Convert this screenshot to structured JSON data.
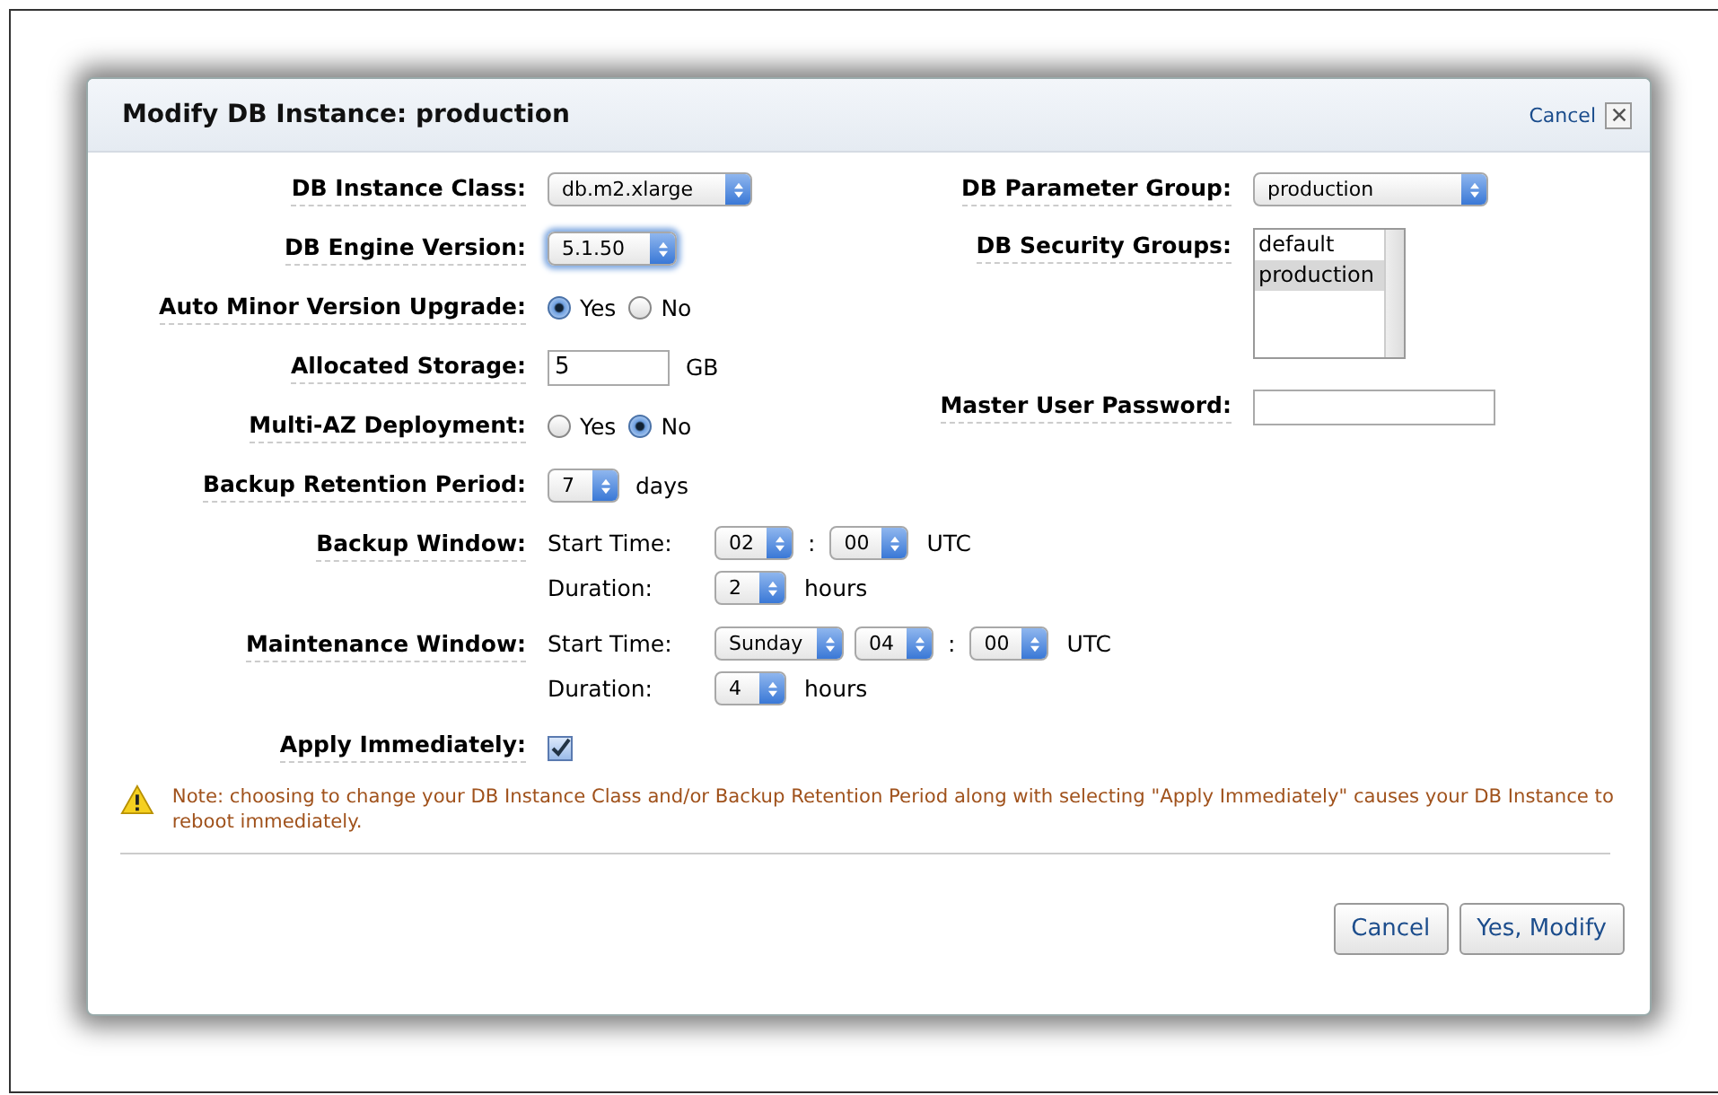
{
  "dialog": {
    "title": "Modify DB Instance: production",
    "close_link": "Cancel"
  },
  "left_fields": [
    {
      "kind": "select",
      "label": "DB Instance Class:",
      "value": "db.m2.xlarge",
      "focused": false
    },
    {
      "kind": "select",
      "label": "DB Engine Version:",
      "value": "5.1.50",
      "focused": true
    },
    {
      "kind": "radio",
      "label": "Auto Minor Version Upgrade:",
      "options": [
        {
          "label": "Yes",
          "selected": true
        },
        {
          "label": "No",
          "selected": false
        }
      ]
    },
    {
      "kind": "text",
      "label": "Allocated Storage:",
      "value": "5",
      "unit": "GB"
    },
    {
      "kind": "radio",
      "label": "Multi-AZ Deployment:",
      "options": [
        {
          "label": "Yes",
          "selected": false
        },
        {
          "label": "No",
          "selected": true
        }
      ]
    },
    {
      "kind": "select",
      "label": "Backup Retention Period:",
      "value": "7",
      "unit": "days",
      "focused": false
    },
    {
      "kind": "window",
      "label": "Backup Window:",
      "rows": [
        {
          "label": "Start Time:",
          "parts": [
            {
              "kind": "select",
              "value": "02"
            },
            {
              "kind": "sep",
              "text": ":"
            },
            {
              "kind": "select",
              "value": "00"
            },
            {
              "kind": "unit",
              "text": "UTC"
            }
          ]
        },
        {
          "label": "Duration:",
          "parts": [
            {
              "kind": "select",
              "value": "2"
            },
            {
              "kind": "unit",
              "text": "hours"
            }
          ]
        }
      ]
    },
    {
      "kind": "window",
      "label": "Maintenance Window:",
      "rows": [
        {
          "label": "Start Time:",
          "parts": [
            {
              "kind": "select",
              "value": "Sunday"
            },
            {
              "kind": "select",
              "value": "04"
            },
            {
              "kind": "sep",
              "text": ":"
            },
            {
              "kind": "select",
              "value": "00"
            },
            {
              "kind": "unit",
              "text": "UTC"
            }
          ]
        },
        {
          "label": "Duration:",
          "parts": [
            {
              "kind": "select",
              "value": "4"
            },
            {
              "kind": "unit",
              "text": "hours"
            }
          ]
        }
      ]
    },
    {
      "kind": "checkbox",
      "label": "Apply Immediately:",
      "checked": true
    }
  ],
  "right_fields": [
    {
      "kind": "select",
      "label": "DB Parameter Group:",
      "value": "production",
      "focused": false
    },
    {
      "kind": "listbox",
      "label": "DB Security Groups:",
      "options": [
        {
          "label": "default",
          "selected": false
        },
        {
          "label": "production",
          "selected": true
        }
      ]
    },
    {
      "kind": "password",
      "label": "Master User Password:"
    }
  ],
  "note": "Note: choosing to change your DB Instance Class and/or Backup Retention Period along with selecting \"Apply Immediately\" causes your DB Instance to reboot immediately.",
  "buttons": [
    "Cancel",
    "Yes, Modify"
  ]
}
